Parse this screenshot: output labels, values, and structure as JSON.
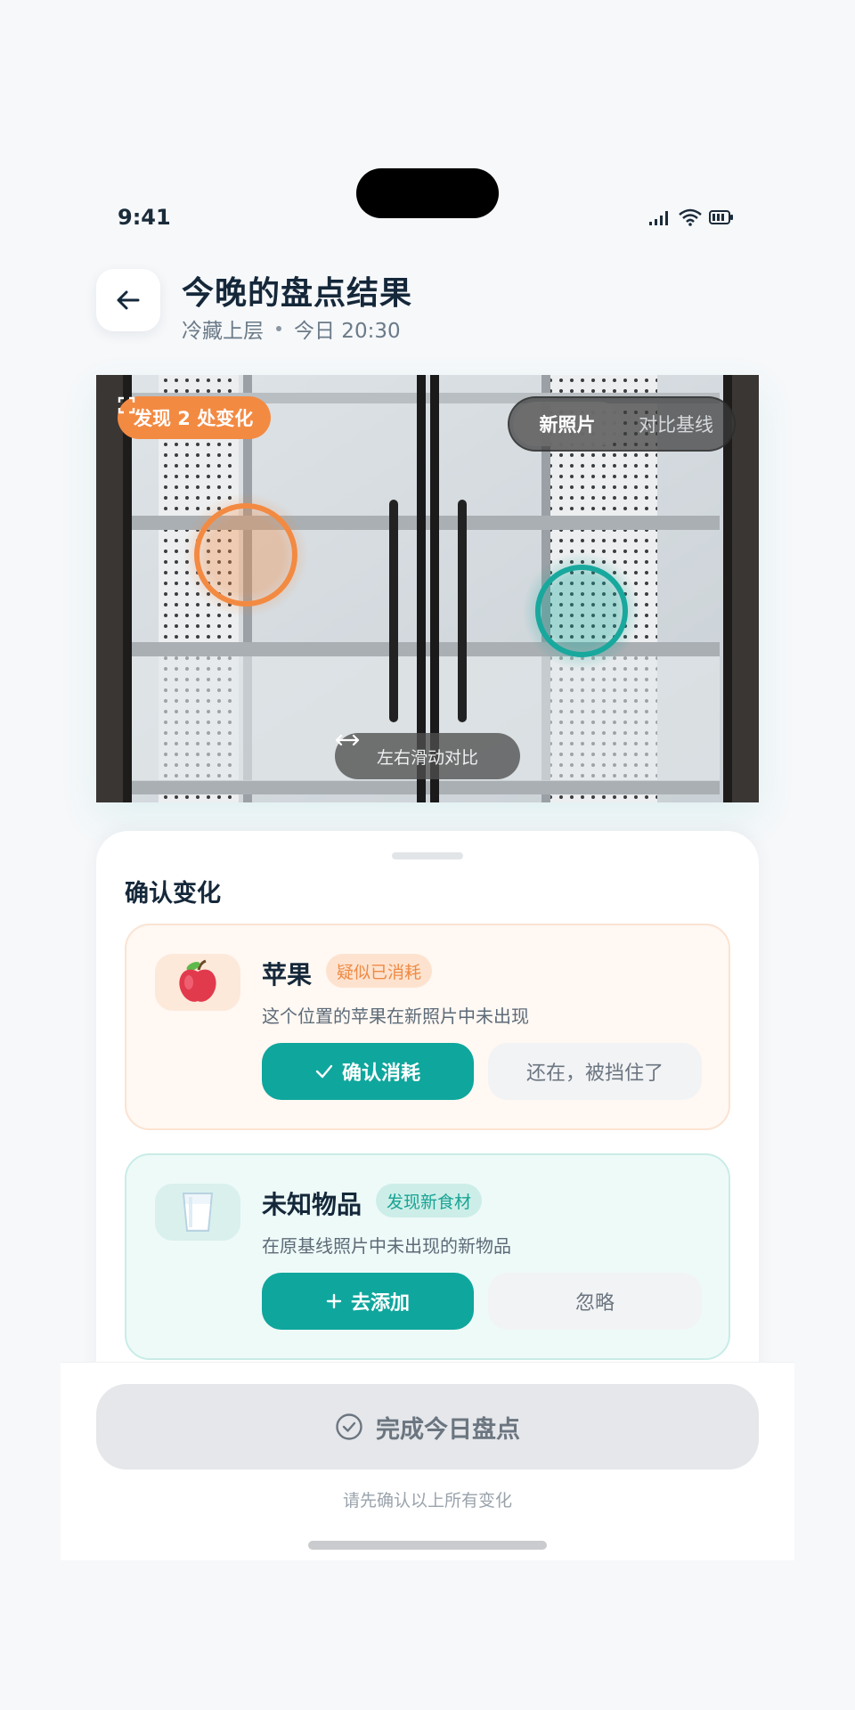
{
  "status_bar": {
    "time": "9:41"
  },
  "header": {
    "title": "今晚的盘点结果",
    "location": "冷藏上层",
    "time": "今日 20:30"
  },
  "photo": {
    "change_badge": "发现 2 处变化",
    "toggle": {
      "options": [
        "新照片",
        "对比基线"
      ],
      "selected": "新照片"
    },
    "slide_hint": "左右滑动对比"
  },
  "section": {
    "title": "确认变化"
  },
  "changes": [
    {
      "name": "苹果",
      "tag": "疑似已消耗",
      "description": "这个位置的苹果在新照片中未出现",
      "primary_label": "确认消耗",
      "secondary_label": "还在，被挡住了",
      "accent": "#f38a42"
    },
    {
      "name": "未知物品",
      "tag": "发现新食材",
      "description": "在原基线照片中未出现的新物品",
      "primary_label": "去添加",
      "secondary_label": "忽略",
      "accent": "#19a89d"
    }
  ],
  "footer": {
    "finish_label": "完成今日盘点",
    "hint": "请先确认以上所有变化"
  },
  "colors": {
    "primary": "#0fa69d",
    "warning": "#f38a42"
  }
}
